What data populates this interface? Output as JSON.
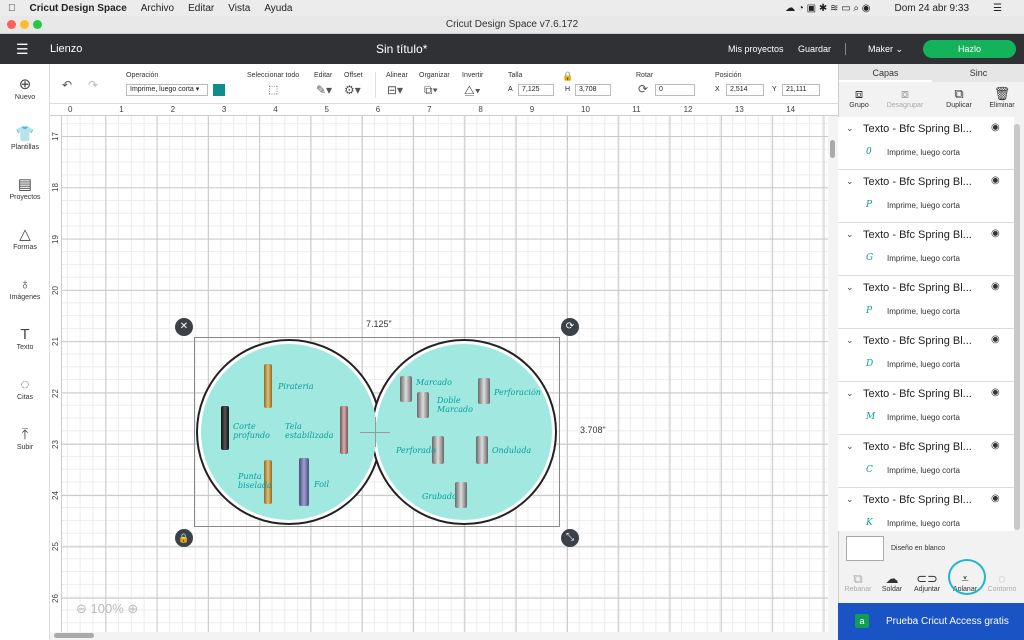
{
  "menubar": {
    "app": "Cricut Design Space",
    "items": [
      "Archivo",
      "Editar",
      "Vista",
      "Ayuda"
    ],
    "clock": "Dom 24 abr  9:33"
  },
  "window": {
    "title": "Cricut Design Space  v7.6.172"
  },
  "header": {
    "section": "Lienzo",
    "doc_title": "Sin título*",
    "my_projects": "Mis proyectos",
    "save": "Guardar",
    "machine": "Maker",
    "make": "Hazlo"
  },
  "sidebar": {
    "items": [
      {
        "label": "Nuevo",
        "icon": "plus-icon"
      },
      {
        "label": "Plantillas",
        "icon": "shirt-icon"
      },
      {
        "label": "Proyectos",
        "icon": "project-icon"
      },
      {
        "label": "Formas",
        "icon": "shapes-icon"
      },
      {
        "label": "Imágenes",
        "icon": "bulb-icon"
      },
      {
        "label": "Texto",
        "icon": "text-icon"
      },
      {
        "label": "Citas",
        "icon": "quote-icon"
      },
      {
        "label": "Subir",
        "icon": "upload-icon"
      }
    ]
  },
  "toolbar": {
    "operation_label": "Operación",
    "operation_value": "Imprime, luego corta",
    "operation_color": "#0f8c8c",
    "select_all": "Seleccionar todo",
    "edit": "Editar",
    "offset": "Offset",
    "align": "Alinear",
    "arrange": "Organizar",
    "flip": "Invertir",
    "size": "Talla",
    "w_label": "A",
    "w_value": "7,125",
    "h_label": "H",
    "h_value": "3,708",
    "rotate": "Rotar",
    "rotate_value": "0",
    "position": "Posición",
    "x_label": "X",
    "x_value": "2,514",
    "y_label": "Y",
    "y_value": "21,111"
  },
  "ruler": {
    "top": [
      "0",
      "1",
      "2",
      "3",
      "4",
      "5",
      "6",
      "7",
      "8",
      "9",
      "10",
      "11",
      "12",
      "13",
      "14"
    ],
    "left": [
      "17",
      "18",
      "19",
      "20",
      "21",
      "22",
      "23",
      "24",
      "25",
      "26"
    ]
  },
  "canvas": {
    "width_label": "7.125\"",
    "height_label": "3.708\"",
    "zoom": "100%",
    "left_labels": [
      "Pirateria",
      "Corte profundo",
      "Tela estabilizada",
      "Punta biselada",
      "Foil"
    ],
    "right_labels": [
      "Marcado",
      "Doble Marcado",
      "Perforación",
      "Perforado",
      "Ondulada",
      "Grabado"
    ],
    "colors": {
      "fill": "#a0e8e0",
      "text": "#0a9e9a"
    }
  },
  "panel": {
    "tabs": [
      "Capas",
      "Sinc"
    ],
    "tools": [
      "Grupo",
      "Desagrupar",
      "Duplicar",
      "Eliminar"
    ],
    "layers": [
      {
        "title": "Texto - Bfc Spring Bl...",
        "sub": "Imprime, luego corta",
        "glyph": "0"
      },
      {
        "title": "Texto - Bfc Spring Bl...",
        "sub": "Imprime, luego corta",
        "glyph": "P"
      },
      {
        "title": "Texto - Bfc Spring Bl...",
        "sub": "Imprime, luego corta",
        "glyph": "G"
      },
      {
        "title": "Texto - Bfc Spring Bl...",
        "sub": "Imprime, luego corta",
        "glyph": "P"
      },
      {
        "title": "Texto - Bfc Spring Bl...",
        "sub": "Imprime, luego corta",
        "glyph": "D"
      },
      {
        "title": "Texto - Bfc Spring Bl...",
        "sub": "Imprime, luego corta",
        "glyph": "M"
      },
      {
        "title": "Texto - Bfc Spring Bl...",
        "sub": "Imprime, luego corta",
        "glyph": "C"
      },
      {
        "title": "Texto - Bfc Spring Bl...",
        "sub": "Imprime, luego corta",
        "glyph": "K"
      }
    ],
    "blank": "Diseño en blanco",
    "bottom": [
      "Rebanar",
      "Soldar",
      "Adjuntar",
      "Aplanar",
      "Contorno"
    ],
    "access": "Prueba Cricut Access gratis"
  }
}
